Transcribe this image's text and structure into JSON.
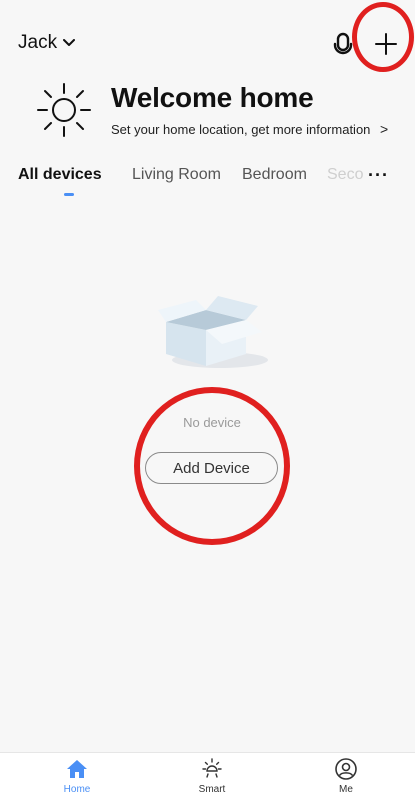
{
  "header": {
    "home_name": "Jack",
    "welcome_title": "Welcome home",
    "welcome_subtitle": "Set your home location, get more information",
    "subtitle_arrow": ">"
  },
  "tabs": [
    {
      "label": "All devices",
      "active": true
    },
    {
      "label": "Living Room",
      "active": false
    },
    {
      "label": "Bedroom",
      "active": false
    },
    {
      "label": "Seco",
      "active": false
    }
  ],
  "more_label": "···",
  "empty_state": {
    "message": "No device",
    "button_label": "Add Device"
  },
  "bottom_nav": [
    {
      "label": "Home",
      "icon": "home-icon",
      "active": true
    },
    {
      "label": "Smart",
      "icon": "smart-icon",
      "active": false
    },
    {
      "label": "Me",
      "icon": "profile-icon",
      "active": false
    }
  ],
  "colors": {
    "accent": "#4a8ff5",
    "highlight_circle": "#e0201f",
    "background": "#f7f7f7"
  }
}
